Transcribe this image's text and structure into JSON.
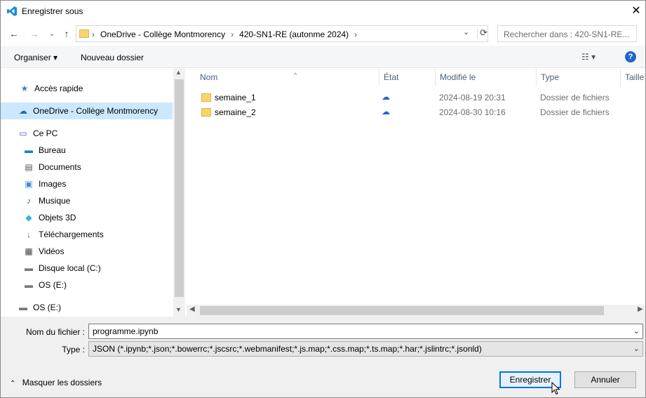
{
  "window": {
    "title": "Enregistrer sous",
    "close_glyph": "✕"
  },
  "nav": {
    "back": "←",
    "forward": "→",
    "recent": "⌄",
    "up": "↑",
    "breadcrumb": [
      "OneDrive - Collège Montmorency",
      "420-SN1-RE (autonme 2024)"
    ],
    "sep": "›",
    "dropdown": "⌄",
    "refresh": "⟳",
    "search_placeholder": "Rechercher dans : 420-SN1-RE..."
  },
  "toolbar": {
    "organise": "Organiser ▾",
    "new_folder": "Nouveau dossier",
    "view": "☷ ▾",
    "help": "?"
  },
  "sidebar": {
    "items": [
      {
        "label": "Accès rapide",
        "icon": "star-icon",
        "glyph": "★"
      },
      {
        "label": "OneDrive - Collège Montmorency",
        "icon": "cloud-icon",
        "glyph": "☁"
      },
      {
        "label": "Ce PC",
        "icon": "computer-icon",
        "glyph": "▭"
      },
      {
        "label": "Bureau",
        "icon": "desktop-icon",
        "glyph": "▬"
      },
      {
        "label": "Documents",
        "icon": "document-icon",
        "glyph": "▤"
      },
      {
        "label": "Images",
        "icon": "image-icon",
        "glyph": "▣"
      },
      {
        "label": "Musique",
        "icon": "music-icon",
        "glyph": "♪"
      },
      {
        "label": "Objets 3D",
        "icon": "cube-icon",
        "glyph": "◆"
      },
      {
        "label": "Téléchargements",
        "icon": "download-icon",
        "glyph": "↓"
      },
      {
        "label": "Vidéos",
        "icon": "film-icon",
        "glyph": "▦"
      },
      {
        "label": "Disque local (C:)",
        "icon": "drive-icon",
        "glyph": "▬"
      },
      {
        "label": "OS (E:)",
        "icon": "drive-icon",
        "glyph": "▬"
      },
      {
        "label": "OS (E:)",
        "icon": "drive-icon",
        "glyph": "▬"
      }
    ],
    "scroll_up": "▲",
    "scroll_down": "▼"
  },
  "columns": [
    "Nom",
    "État",
    "Modifié le",
    "Type",
    "Taille"
  ],
  "sort_arrow": "^",
  "files": [
    {
      "name": "semaine_1",
      "status_icon": "☁",
      "modified": "2024-08-19 20:31",
      "type": "Dossier de fichiers"
    },
    {
      "name": "semaine_2",
      "status_icon": "☁",
      "modified": "2024-08-30 10:16",
      "type": "Dossier de fichiers"
    }
  ],
  "hscroll": {
    "left": "◀",
    "right": "▶"
  },
  "form": {
    "filename_label": "Nom du fichier :",
    "filename_value": "programme.ipynb",
    "type_label": "Type :",
    "type_value": "JSON (*.ipynb;*.json;*.bowerrc;*.jscsrc;*.webmanifest;*.js.map;*.css.map;*.ts.map;*.har;*.jslintrc;*.jsonld)",
    "dropdown": "⌄"
  },
  "footer": {
    "hide_folders": "Masquer les dossiers",
    "hide_chevron": "⌃",
    "save": "Enregistrer",
    "cancel": "Annuler"
  },
  "colors": {
    "accent": "#0078d7",
    "selection": "#cce8ff",
    "folder": "#f7d56c"
  }
}
